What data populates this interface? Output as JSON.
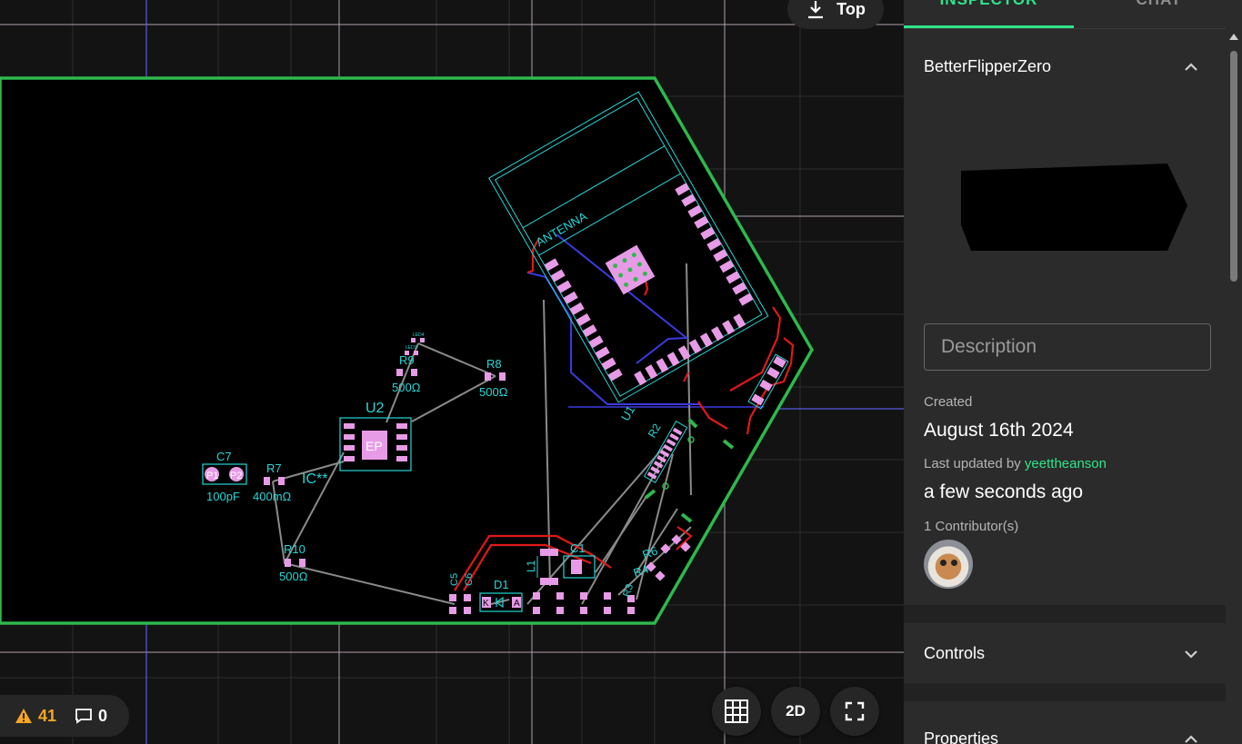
{
  "viewport": {
    "view_label": "Top",
    "warnings_count": "41",
    "comments_count": "0",
    "mode_2d_label": "2D"
  },
  "pcb": {
    "antenna_label": "ANTENNA",
    "components": {
      "c7": "C7",
      "c7_value": "100pF",
      "c7_p1": "P1",
      "c7_p2": "P2",
      "r7": "R7",
      "r7_value": "400mΩ",
      "ic": "IC**",
      "u2": "U2",
      "u2_pad": "EP",
      "r9": "R9",
      "r9_value": "500Ω",
      "r8": "R8",
      "r8_value": "500Ω",
      "r10": "R10",
      "r10_value": "500Ω",
      "u1": "U1",
      "r2": "R2",
      "d1": "D1",
      "d1_k": "K",
      "d1_a": "A",
      "c5": "C5",
      "c6": "C6",
      "l1": "L1",
      "c1": "C1",
      "r6": "R6",
      "r4": "R4",
      "r3": "R3",
      "led4": "LED4",
      "led3": "LED3"
    }
  },
  "panel": {
    "tabs": {
      "inspector": "INSPECTOR",
      "chat": "CHAT"
    },
    "project_title": "BetterFlipperZero",
    "description_placeholder": "Description",
    "created_label": "Created",
    "created_value": "August 16th 2024",
    "last_updated_prefix": "Last updated by ",
    "last_updated_user": "yeettheanson",
    "last_updated_value": "a few seconds ago",
    "contributors": "1 Contributor(s)",
    "controls_label": "Controls",
    "properties_label": "Properties"
  },
  "colors": {
    "accent": "#2ee68a",
    "board_outline": "#2fb84c",
    "silkscreen": "#26d6d6",
    "pad": "#e79be6",
    "trace_red": "#e01818",
    "trace_blue": "#3a3ae0",
    "ratsnest": "#8a8a8a",
    "warning": "#f5a623",
    "link": "#2ee68a"
  }
}
